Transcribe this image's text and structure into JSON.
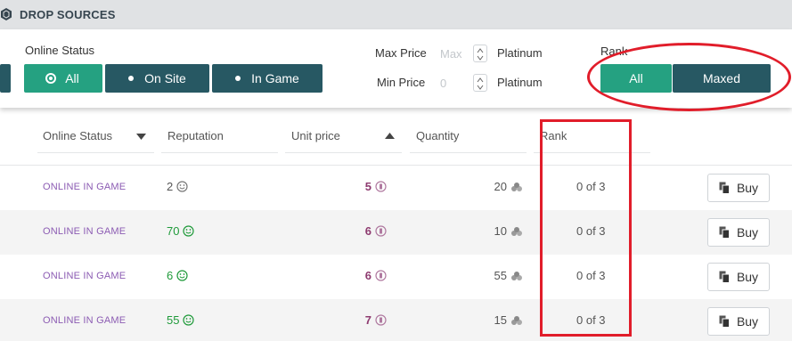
{
  "colors": {
    "accent": "#25a181",
    "dark_button": "#275863",
    "status_text": "#8c5cb3",
    "price_text": "#8e3b70",
    "reputation_text": "#1f9a3a",
    "annotation": "#e11d2a"
  },
  "header": {
    "title": "DROP SOURCES",
    "icon": "hexagon-icon"
  },
  "filters": {
    "online_status_label": "Online Status",
    "online_status_options": [
      "All",
      "On Site",
      "In Game"
    ],
    "max_price_label": "Max Price",
    "max_price_placeholder": "Max",
    "min_price_label": "Min Price",
    "min_price_value": "0",
    "currency_label": "Platinum",
    "rank_label": "Rank",
    "rank_options": [
      "All",
      "Maxed"
    ]
  },
  "table": {
    "columns": [
      "Online Status",
      "Reputation",
      "Unit price",
      "Quantity",
      "Rank"
    ],
    "buy_label": "Buy",
    "rows": [
      {
        "status": "ONLINE IN GAME",
        "reputation": "2",
        "price": "5",
        "quantity": "20",
        "rank": "0 of 3"
      },
      {
        "status": "ONLINE IN GAME",
        "reputation": "70",
        "price": "6",
        "quantity": "10",
        "rank": "0 of 3"
      },
      {
        "status": "ONLINE IN GAME",
        "reputation": "6",
        "price": "6",
        "quantity": "55",
        "rank": "0 of 3"
      },
      {
        "status": "ONLINE IN GAME",
        "reputation": "55",
        "price": "7",
        "quantity": "15",
        "rank": "0 of 3"
      }
    ]
  }
}
